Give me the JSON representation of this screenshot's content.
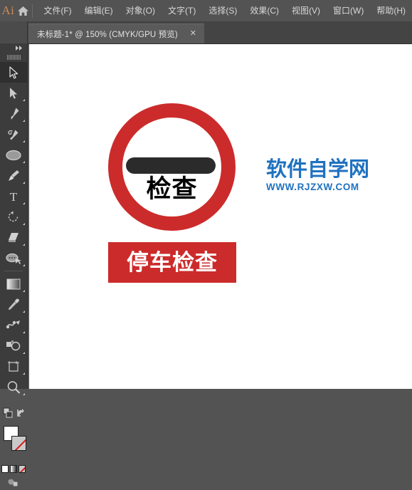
{
  "app": {
    "logo_text": "Ai",
    "home_icon": "home-icon"
  },
  "menubar": {
    "items": [
      {
        "label": "文件(F)"
      },
      {
        "label": "编辑(E)"
      },
      {
        "label": "对象(O)"
      },
      {
        "label": "文字(T)"
      },
      {
        "label": "选择(S)"
      },
      {
        "label": "效果(C)"
      },
      {
        "label": "视图(V)"
      },
      {
        "label": "窗口(W)"
      },
      {
        "label": "帮助(H)"
      }
    ]
  },
  "tabbar": {
    "tab_title": "未标题-1* @ 150% (CMYK/GPU 预览)",
    "close_label": "✕"
  },
  "tools": {
    "collapse_label": "▸▸",
    "items": [
      {
        "name": "selection-tool",
        "active": true
      },
      {
        "name": "direct-selection-tool",
        "active": false
      },
      {
        "name": "pen-tool",
        "active": false
      },
      {
        "name": "curvature-tool",
        "active": false
      },
      {
        "name": "ellipse-tool",
        "active": false
      },
      {
        "name": "paintbrush-tool",
        "active": false
      },
      {
        "name": "type-tool",
        "active": false
      },
      {
        "name": "rotate-tool",
        "active": false
      },
      {
        "name": "eraser-tool",
        "active": false
      },
      {
        "name": "shaper-tool",
        "active": false
      },
      {
        "name": "gradient-tool",
        "active": false
      },
      {
        "name": "eyedropper-tool",
        "active": false
      },
      {
        "name": "blend-tool",
        "active": false
      },
      {
        "name": "shape-builder-tool",
        "active": false
      },
      {
        "name": "artboard-tool",
        "active": false
      },
      {
        "name": "zoom-tool",
        "active": false
      }
    ],
    "fill_color": "#ffffff",
    "stroke_color": "none",
    "accent_red": "#d61b1b"
  },
  "artwork": {
    "sign_ring_color": "#cc2b2b",
    "sign_bar_color": "#2b2b2b",
    "sign_label": "检查",
    "banner_color": "#cc2b2b",
    "banner_text": "停车检查",
    "banner_text_color": "#ffffff"
  },
  "watermark": {
    "title": "软件自学网",
    "url": "WWW.RJZXW.COM",
    "color": "#1f72c0"
  }
}
